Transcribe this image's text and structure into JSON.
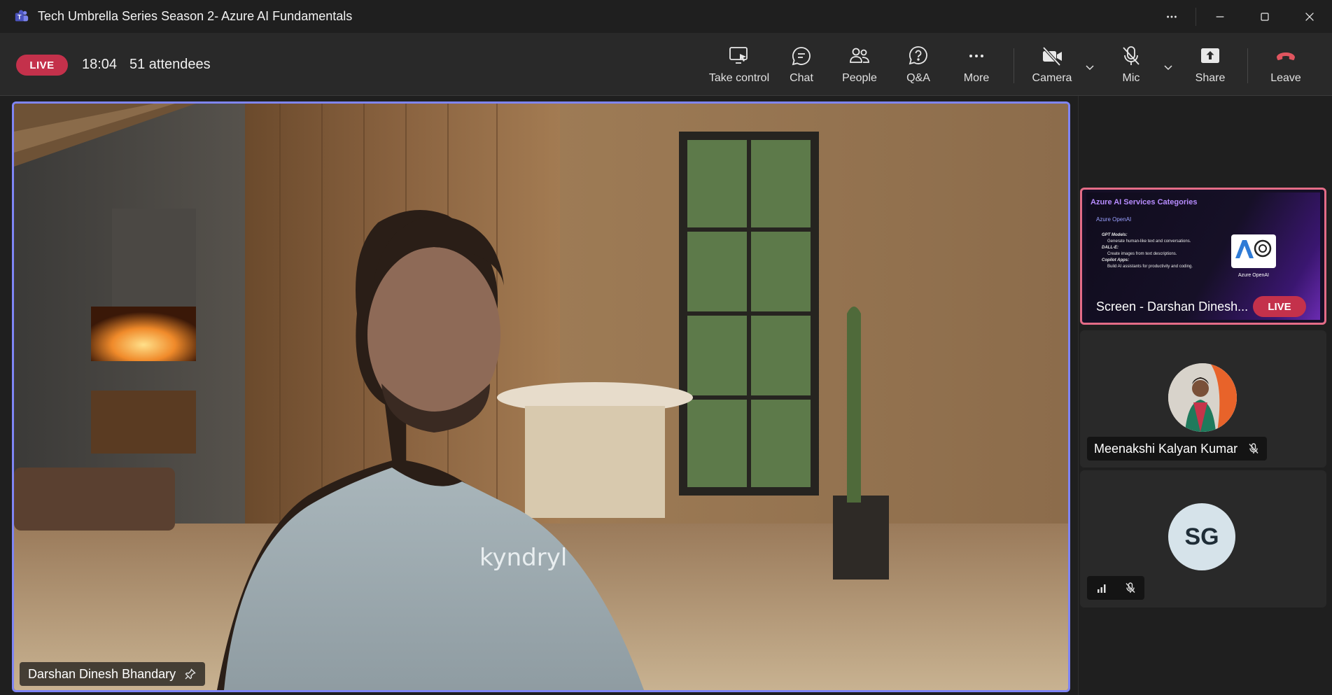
{
  "window": {
    "title": "Tech Umbrella Series Season 2- Azure AI Fundamentals"
  },
  "meeting": {
    "live_label": "LIVE",
    "elapsed": "18:04",
    "attendees": "51 attendees"
  },
  "toolbar": {
    "take_control": "Take control",
    "chat": "Chat",
    "people": "People",
    "qa": "Q&A",
    "more": "More",
    "camera": "Camera",
    "mic": "Mic",
    "share": "Share",
    "leave": "Leave"
  },
  "stage": {
    "presenter_name": "Darshan Dinesh Bhandary",
    "shirt_logo": "kyndryl"
  },
  "sidebar": {
    "screen_share": {
      "slide_title": "Azure AI Services Categories",
      "slide_subtitle": "Azure OpenAI",
      "slide_items": [
        "GPT Models:",
        "Generate human-like text and conversations.",
        "DALL-E:",
        "Create images from text descriptions.",
        "Copilot Apps:",
        "Build AI assistants for productivity and coding."
      ],
      "slide_logo_caption": "Azure OpenAI",
      "label": "Screen - Darshan Dinesh...",
      "live_label": "LIVE"
    },
    "participant_2": {
      "name": "Meenakshi Kalyan Kumar"
    },
    "participant_3": {
      "initials": "SG"
    }
  },
  "colors": {
    "live_red": "#c4314b",
    "active_speaker": "#7f85f5",
    "screen_highlight": "#e46c87",
    "leave_red": "#e0555f"
  }
}
